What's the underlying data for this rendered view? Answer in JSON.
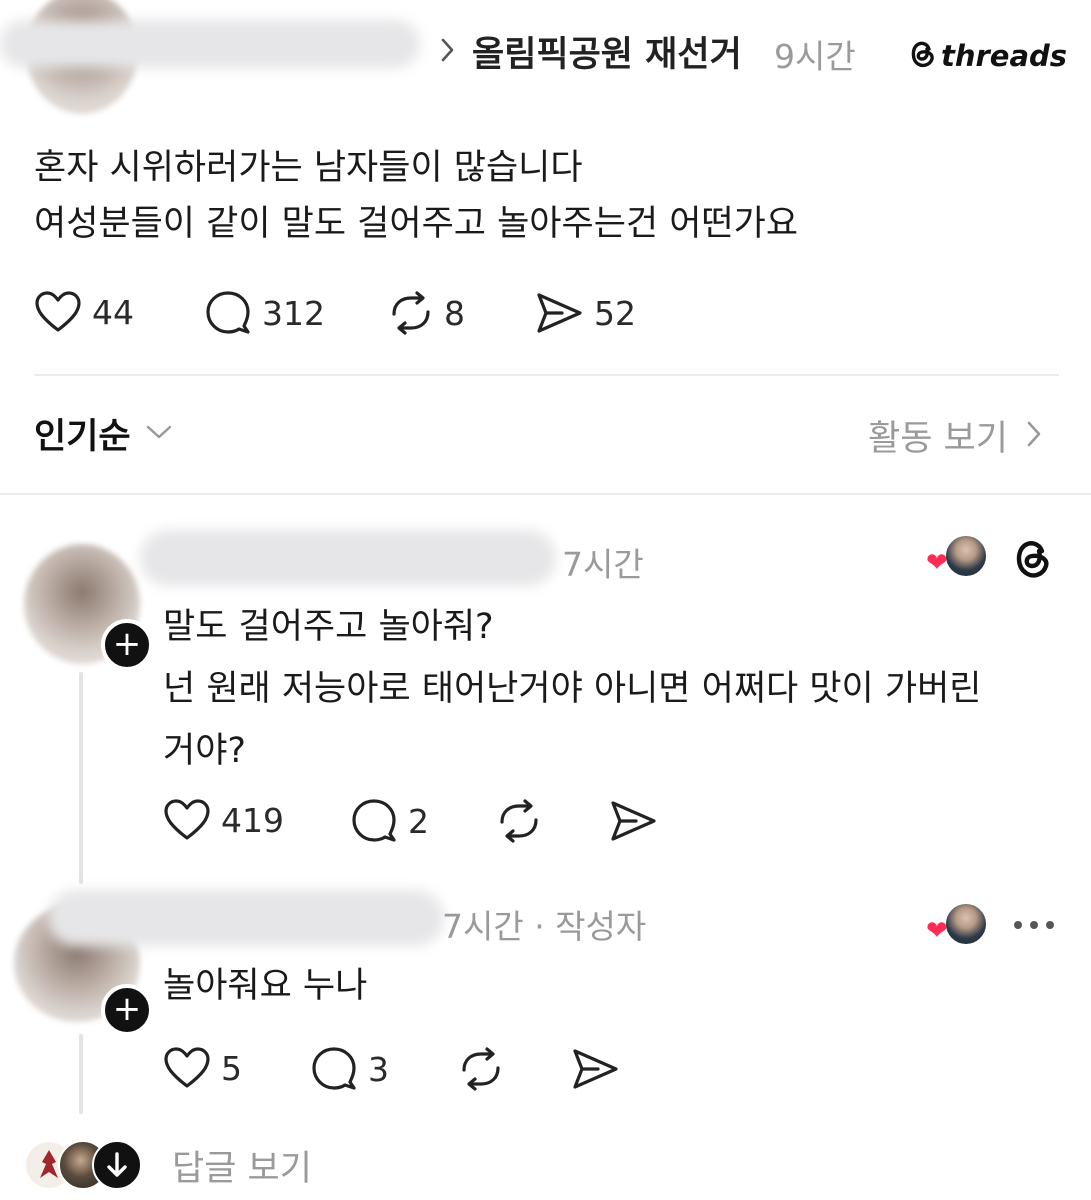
{
  "post": {
    "context": "올림픽공원 재선거",
    "time": "9시간",
    "brand": "threads",
    "lines": [
      "혼자 시위하러가는 남자들이 많습니다",
      "여성분들이 같이 말도 걸어주고 놀아주는건 어떤가요"
    ],
    "likes": "44",
    "comments": "312",
    "reposts": "8",
    "shares": "52"
  },
  "sort": {
    "label": "인기순",
    "activity": "활동 보기"
  },
  "reply1": {
    "time": "7시간",
    "lines": [
      "말도 걸어주고 놀아줘?",
      "넌 원래 저능아로 태어난거야 아니면 어쩌다 맛이 가버린",
      "거야?"
    ],
    "likes": "419",
    "comments": "2"
  },
  "reply2": {
    "meta": "7시간 · 작성자",
    "text": "놀아줘요 누나",
    "likes": "5",
    "comments": "3"
  },
  "view_replies": "답글 보기",
  "icons": [
    "chevron-right-icon",
    "threads-logo-icon",
    "heart-icon",
    "comment-icon",
    "repost-icon",
    "share-icon",
    "chevron-down-icon",
    "more-icon",
    "plus-icon",
    "arrow-down-icon"
  ],
  "colors": {
    "like_red": "#ff2d55",
    "muted": "#9a9a9a"
  }
}
